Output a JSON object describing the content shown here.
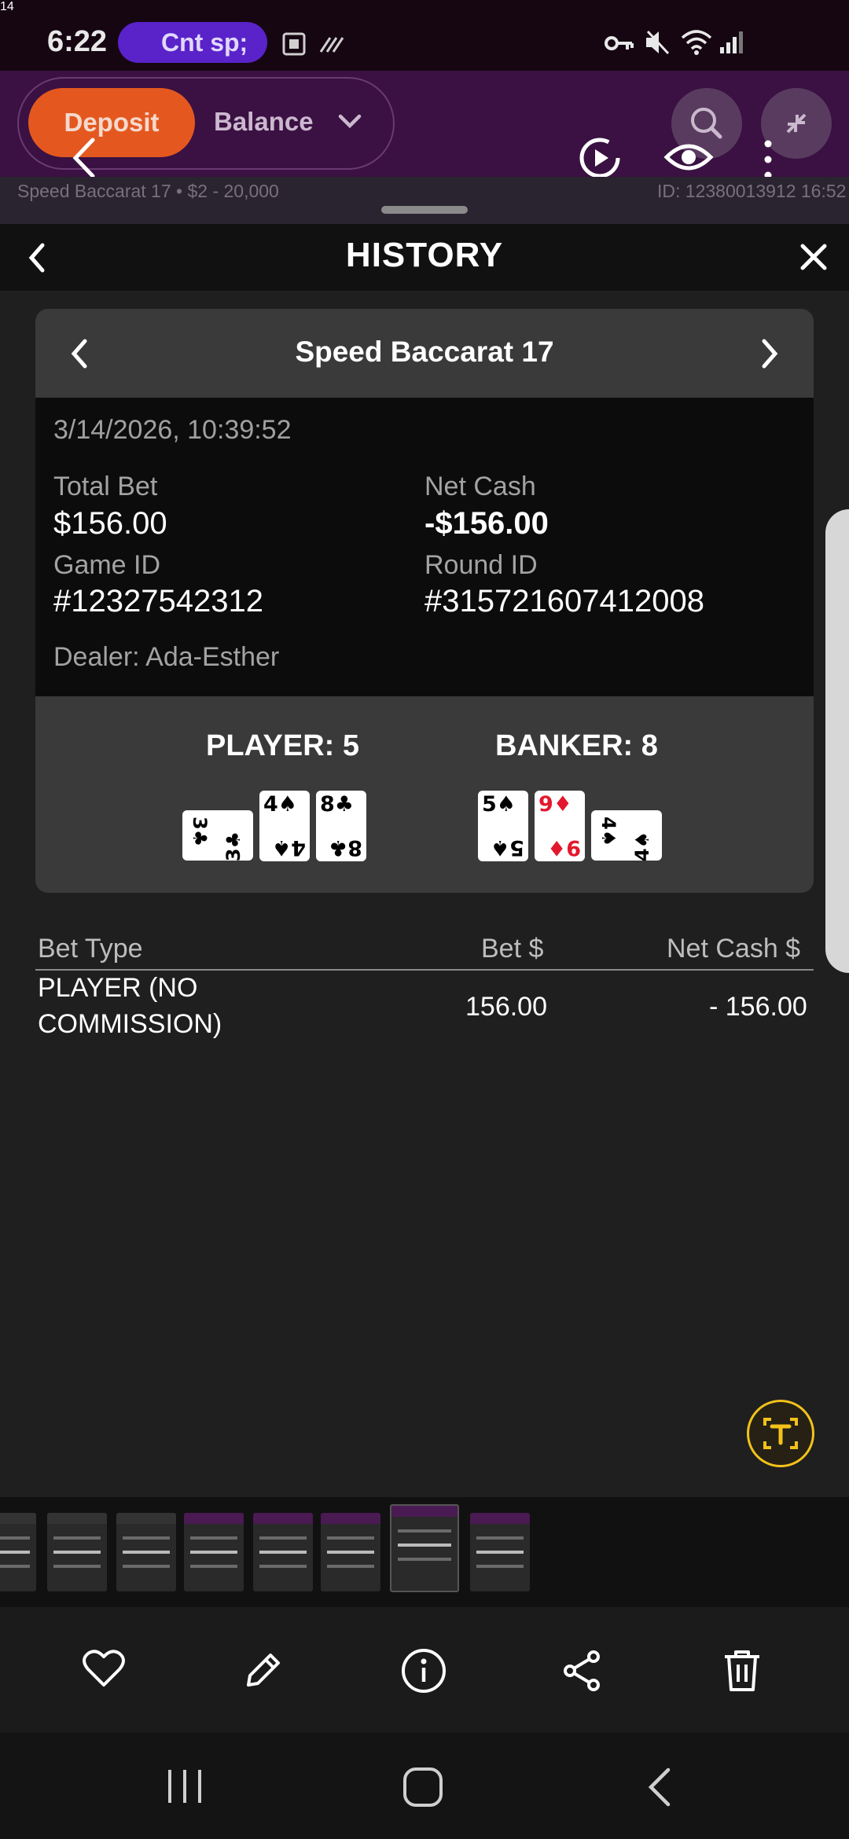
{
  "status_bar": {
    "time": "6:22",
    "pill_text": "Cnt sp;",
    "battery": "14"
  },
  "game_header": {
    "deposit_label": "Deposit",
    "balance_label": "Balance",
    "game_info": "Speed Baccarat 17 • $2 - 20,000",
    "id_text": "ID: 12380013912 16:52"
  },
  "history": {
    "title": "HISTORY",
    "game_name": "Speed Baccarat 17",
    "datetime": "3/14/2026, 10:39:52",
    "total_bet_label": "Total Bet",
    "total_bet_value": "$156.00",
    "net_cash_label": "Net Cash",
    "net_cash_value": "-$156.00",
    "game_id_label": "Game ID",
    "game_id_value": "#12327542312",
    "round_id_label": "Round ID",
    "round_id_value": "#315721607412008",
    "dealer": "Dealer: Ada-Esther",
    "player_label": "PLAYER: 5",
    "banker_label": "BANKER: 8",
    "player_cards": [
      {
        "rank": "3",
        "suit": "♣",
        "color": "black",
        "rotated": true
      },
      {
        "rank": "4",
        "suit": "♠",
        "color": "black",
        "rotated": false
      },
      {
        "rank": "8",
        "suit": "♣",
        "color": "black",
        "rotated": false
      }
    ],
    "banker_cards": [
      {
        "rank": "5",
        "suit": "♠",
        "color": "black",
        "rotated": false
      },
      {
        "rank": "9",
        "suit": "♦",
        "color": "red",
        "rotated": false
      },
      {
        "rank": "4",
        "suit": "♠",
        "color": "black",
        "rotated": true
      }
    ]
  },
  "bets_table": {
    "headers": [
      "Bet Type",
      "Bet $",
      "Net Cash $"
    ],
    "rows": [
      {
        "bet_type_line1": "PLAYER (NO",
        "bet_type_line2": "COMMISSION)",
        "bet": "156.00",
        "net_cash": "- 156.00"
      }
    ]
  },
  "icons": {
    "gallery_actions": [
      "heart-icon",
      "pencil-icon",
      "info-icon",
      "share-icon",
      "trash-icon"
    ],
    "nav": [
      "recents-icon",
      "home-icon",
      "back-icon"
    ]
  },
  "colors": {
    "deposit": "#e4581f",
    "header_purple": "#3a1142",
    "red_suit": "#e3182d",
    "scan_accent": "#f2c21b"
  }
}
